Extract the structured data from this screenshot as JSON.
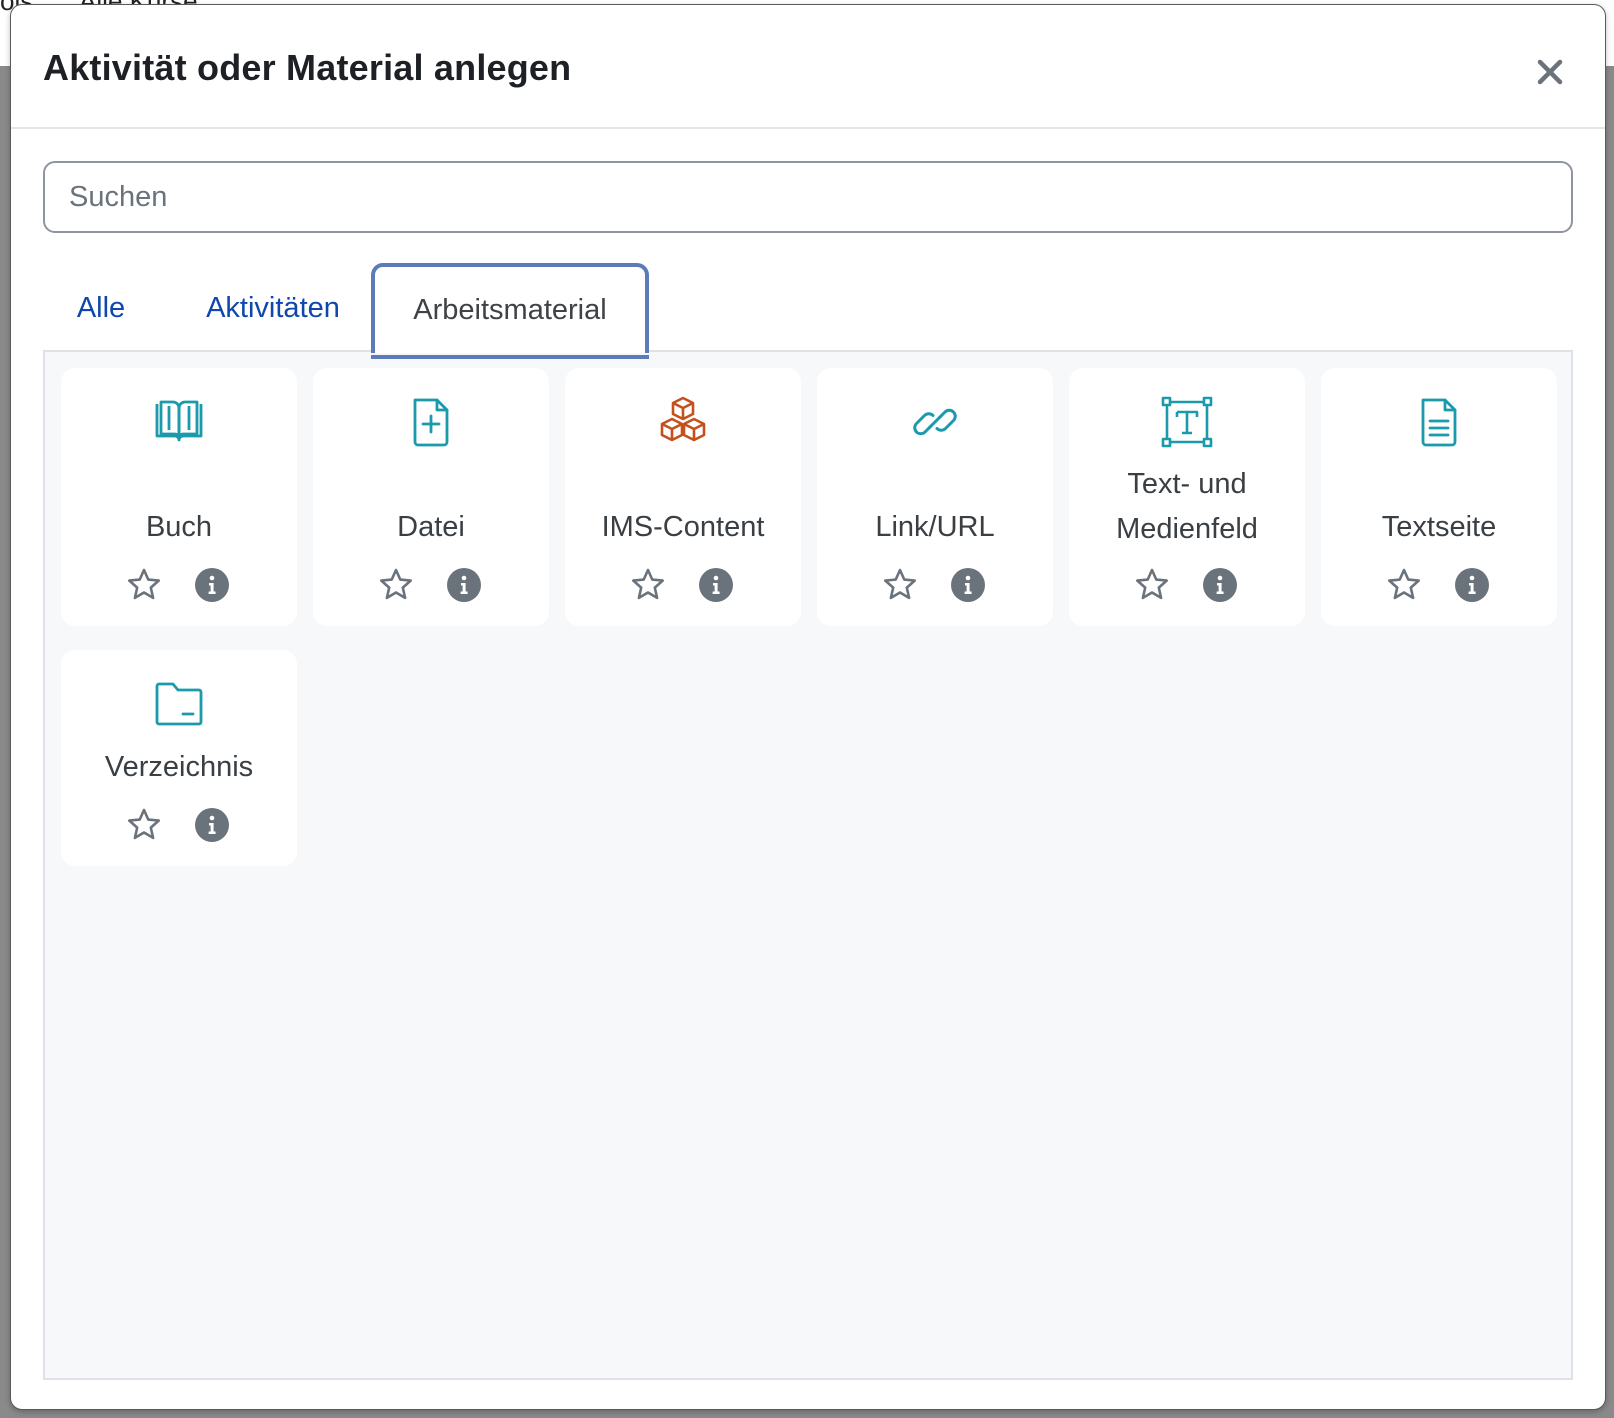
{
  "background": {
    "items": [
      "ols",
      "Alle Kurse"
    ]
  },
  "modal": {
    "title": "Aktivität oder Material anlegen",
    "close_label": "×"
  },
  "search": {
    "placeholder": "Suchen",
    "value": ""
  },
  "tabs": [
    {
      "label": "Alle",
      "active": false
    },
    {
      "label": "Aktivitäten",
      "active": false
    },
    {
      "label": "Arbeitsmaterial",
      "active": true
    }
  ],
  "items": [
    {
      "label": "Buch",
      "icon": "book-icon",
      "color": "#1a9aaa"
    },
    {
      "label": "Datei",
      "icon": "file-plus-icon",
      "color": "#1a9aaa"
    },
    {
      "label": "IMS-Content",
      "icon": "cubes-icon",
      "color": "#c4501c"
    },
    {
      "label": "Link/URL",
      "icon": "link-icon",
      "color": "#1a9aaa"
    },
    {
      "label_line1": "Text- und",
      "label_line2": "Medienfeld",
      "icon": "text-frame-icon",
      "color": "#1a9aaa"
    },
    {
      "label": "Textseite",
      "icon": "document-icon",
      "color": "#1a9aaa"
    },
    {
      "label": "Verzeichnis",
      "icon": "folder-icon",
      "color": "#1a9aaa"
    }
  ],
  "colors": {
    "teal": "#1a9aaa",
    "orange": "#c4501c",
    "tab_link": "#0f47ad",
    "active_tab_border": "#5b7cb8",
    "info_badge": "#6a737b"
  }
}
